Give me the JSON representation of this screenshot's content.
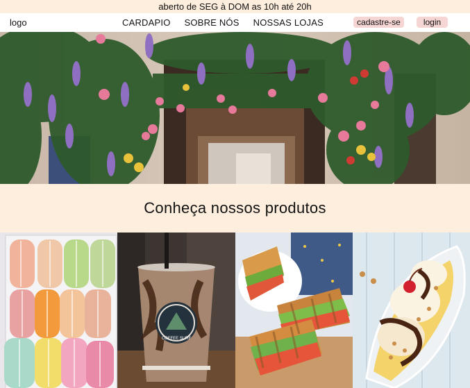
{
  "topbar": {
    "hours": "aberto de SEG à DOM as 10h até 20h"
  },
  "nav": {
    "logo": "logo",
    "links": [
      "CARDAPIO",
      "SOBRE NÓS",
      "NOSSAS LOJAS"
    ],
    "signup": "cadastre-se",
    "login": "login"
  },
  "section": {
    "title": "Conheça nossos produtos"
  },
  "products": [
    {
      "icon": "macarons-photo"
    },
    {
      "icon": "iced-coffee-photo",
      "cup_text": "COFFEE SURF"
    },
    {
      "icon": "sandwich-photo"
    },
    {
      "icon": "banana-split-photo"
    }
  ],
  "colors": {
    "background": "#fdeede",
    "pill": "#f6d6d4",
    "nav": "#ffffff"
  }
}
